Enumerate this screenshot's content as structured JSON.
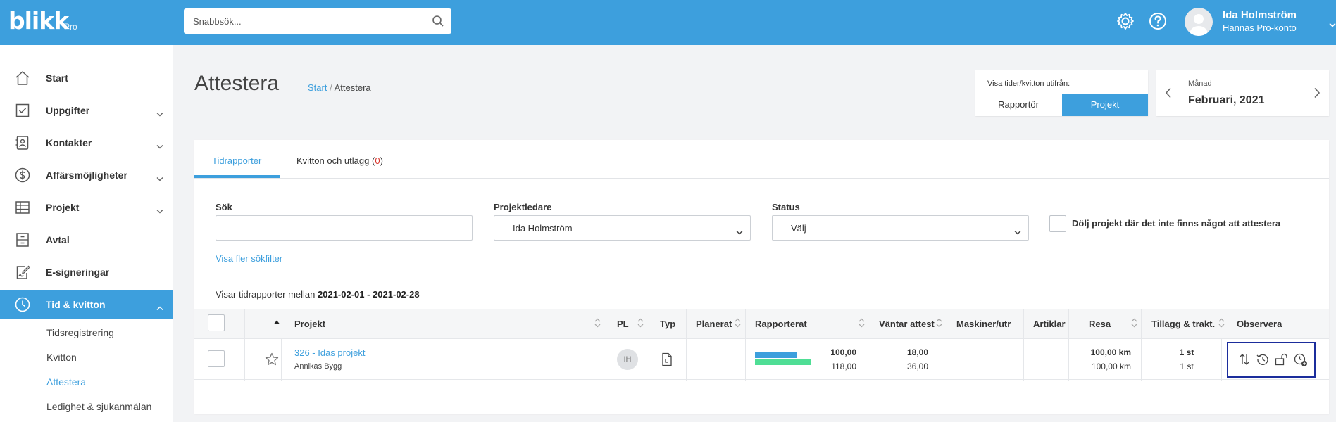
{
  "app": {
    "logo": "blikk",
    "logo_sub": "Pro",
    "search_placeholder": "Snabbsök...",
    "user_name": "Ida Holmström",
    "user_account": "Hannas Pro-konto"
  },
  "sidebar": {
    "items": [
      {
        "label": "Start",
        "icon": "home-icon"
      },
      {
        "label": "Uppgifter",
        "icon": "checkbox-icon"
      },
      {
        "label": "Kontakter",
        "icon": "contacts-icon"
      },
      {
        "label": "Affärsmöjligheter",
        "icon": "dollar-icon"
      },
      {
        "label": "Projekt",
        "icon": "table-icon"
      },
      {
        "label": "Avtal",
        "icon": "cabinet-icon"
      },
      {
        "label": "E-signeringar",
        "icon": "signature-icon"
      },
      {
        "label": "Tid & kvitton",
        "icon": "clock-icon"
      }
    ],
    "sub_items": [
      "Tidsregistrering",
      "Kvitton",
      "Attestera",
      "Ledighet & sjukanmälan"
    ]
  },
  "header": {
    "title": "Attestera",
    "breadcrumb_home": "Start",
    "breadcrumb_sep": "/",
    "breadcrumb_current": "Attestera"
  },
  "view_toggle": {
    "label": "Visa tider/kvitton utifrån:",
    "option_1": "Rapportör",
    "option_2": "Projekt",
    "selected": "Projekt"
  },
  "month_picker": {
    "label": "Månad",
    "value": "Februari, 2021"
  },
  "tabs": {
    "tab_1": "Tidrapporter",
    "tab_2": "Kvitton och utlägg",
    "tab_2_count_open": "(",
    "tab_2_count": "0",
    "tab_2_count_close": ")"
  },
  "filters": {
    "search_label": "Sök",
    "search_value": "",
    "manager_label": "Projektledare",
    "manager_value": "Ida Holmström",
    "status_label": "Status",
    "status_value": "Välj",
    "hide_label": "Dölj projekt där det inte finns något att attestera",
    "more_filters": "Visa fler sökfilter"
  },
  "range": {
    "prefix": "Visar tidrapporter mellan",
    "value": "2021-02-01 - 2021-02-28"
  },
  "table": {
    "columns": {
      "project": "Projekt",
      "pl": "PL",
      "type": "Typ",
      "planned": "Planerat",
      "reported": "Rapporterat",
      "pending": "Väntar attest",
      "machines": "Maskiner/utr",
      "articles": "Artiklar",
      "travel": "Resa",
      "allowance": "Tillägg & trakt.",
      "observe": "Observera"
    },
    "rows": [
      {
        "project": "326 - Idas projekt",
        "customer": "Annikas Bygg",
        "pl_initials": "IH",
        "reported_1": "100,00",
        "reported_2": "118,00",
        "reported_bar_1": 0.76,
        "reported_bar_2": 1.0,
        "pending_1": "18,00",
        "pending_2": "36,00",
        "travel_1": "100,00 km",
        "travel_2": "100,00 km",
        "allowance_1": "1 st",
        "allowance_2": "1 st"
      }
    ]
  },
  "colors": {
    "primary": "#3d9fdd",
    "bar_blue": "#3d9fdd",
    "bar_green": "#4fde95",
    "count_red": "#d9342b",
    "highlight": "#1b2d9c"
  }
}
